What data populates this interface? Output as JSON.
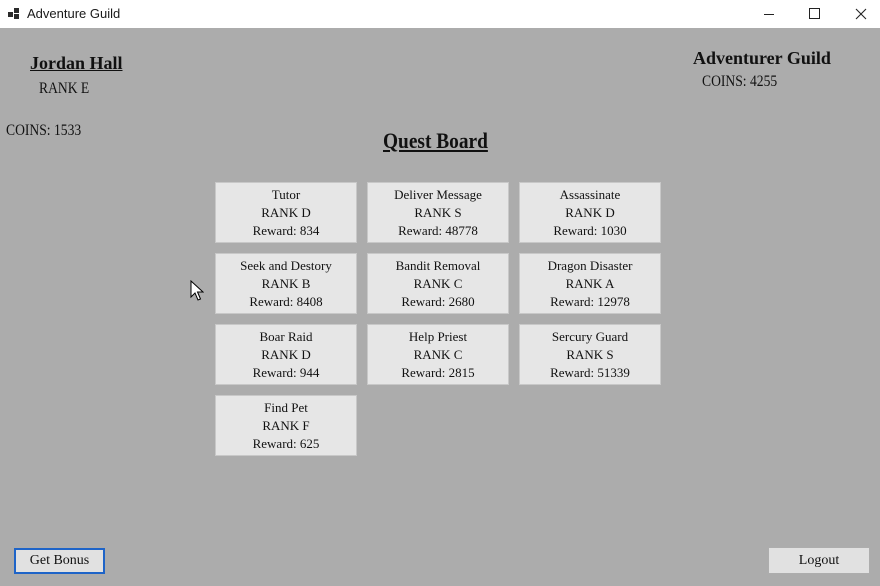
{
  "window": {
    "title": "Adventure Guild"
  },
  "user": {
    "name": "Jordan Hall",
    "rank": "RANK E",
    "coins": "COINS: 1533"
  },
  "guild": {
    "name": "Adventurer Guild",
    "coins": "COINS: 4255"
  },
  "board": {
    "title": "Quest Board"
  },
  "quests": [
    {
      "name": "Tutor",
      "rank": "RANK D",
      "reward": "Reward: 834"
    },
    {
      "name": "Deliver Message",
      "rank": "RANK S",
      "reward": "Reward: 48778"
    },
    {
      "name": "Assassinate",
      "rank": "RANK D",
      "reward": "Reward: 1030"
    },
    {
      "name": "Seek and Destory",
      "rank": "RANK B",
      "reward": "Reward: 8408"
    },
    {
      "name": "Bandit Removal",
      "rank": "RANK C",
      "reward": "Reward: 2680"
    },
    {
      "name": "Dragon Disaster",
      "rank": "RANK A",
      "reward": "Reward: 12978"
    },
    {
      "name": "Boar Raid",
      "rank": "RANK D",
      "reward": "Reward: 944"
    },
    {
      "name": "Help Priest",
      "rank": "RANK C",
      "reward": "Reward: 2815"
    },
    {
      "name": "Sercury Guard",
      "rank": "RANK S",
      "reward": "Reward: 51339"
    },
    {
      "name": "Find Pet",
      "rank": "RANK F",
      "reward": "Reward: 625"
    }
  ],
  "buttons": {
    "bonus": "Get Bonus",
    "logout": "Logout"
  },
  "icons": {
    "app": "app-grid-icon",
    "minimize": "minimize-icon",
    "maximize": "maximize-icon",
    "close": "close-icon",
    "cursor": "mouse-pointer-icon"
  }
}
